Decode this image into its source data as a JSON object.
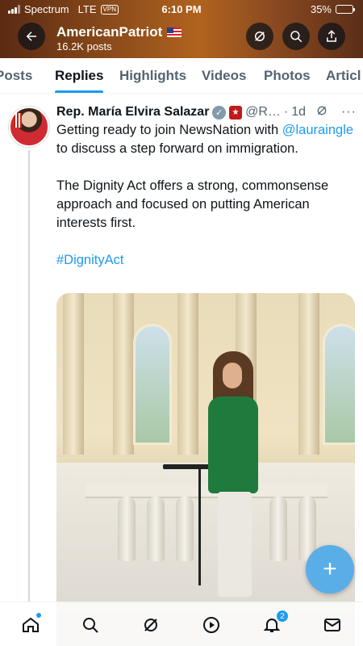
{
  "status_bar": {
    "carrier": "Spectrum",
    "network": "LTE",
    "vpn": "VPN",
    "time": "6:10 PM",
    "battery": "35%",
    "battery_level": 0.35,
    "battery_color": "#ffcc00"
  },
  "header": {
    "account_name": "AmericanPatriot",
    "post_count": "16.2K posts",
    "back_icon": "arrow-left-icon",
    "grok_icon": "grok-icon",
    "search_icon": "search-icon",
    "share_icon": "share-icon"
  },
  "tabs": [
    {
      "label": "Posts",
      "active": false
    },
    {
      "label": "Replies",
      "active": true
    },
    {
      "label": "Highlights",
      "active": false
    },
    {
      "label": "Videos",
      "active": false
    },
    {
      "label": "Photos",
      "active": false
    },
    {
      "label": "Articl",
      "active": false
    }
  ],
  "tweet": {
    "author_name": "Rep. María Elvira Salazar",
    "handle": "@R…",
    "separator": "·",
    "time": "1d",
    "verified_color": "#829aab",
    "body_line1_pre": "Getting ready to join NewsNation with",
    "mention": "@lauraingle",
    "body_line1_post": " to discuss a step forward on immigration.",
    "body_paragraph2": "The Dignity Act offers a strong, commonsense approach and focused on putting American interests first.",
    "hashtag": "#DignityAct"
  },
  "fab": {
    "label": "+",
    "color": "#5aaee8"
  },
  "bottom_nav": {
    "items": [
      "home-icon",
      "search-icon",
      "grok-icon",
      "play-icon",
      "notifications-icon",
      "messages-icon"
    ],
    "notification_count": "2",
    "accent": "#1d9bf0"
  }
}
